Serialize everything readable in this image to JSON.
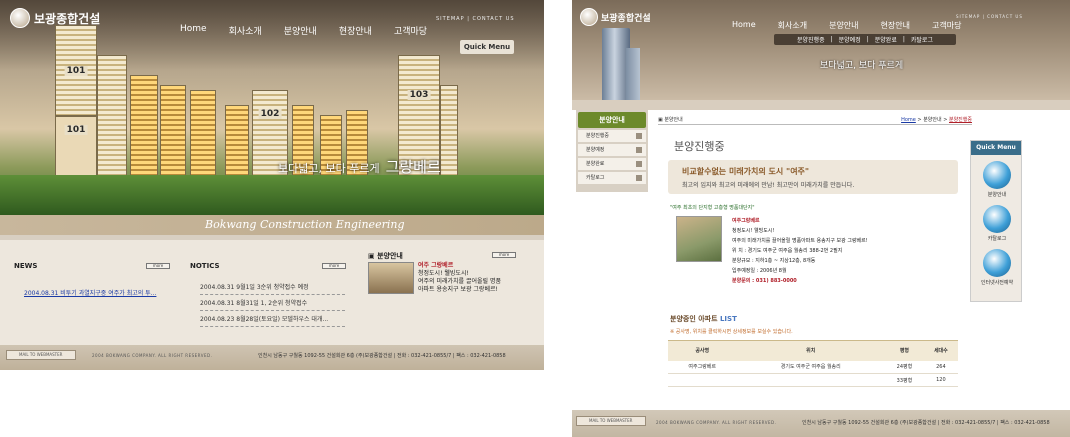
{
  "left": {
    "logo_text": "보광종합건설",
    "nav": [
      "Home",
      "회사소개",
      "분양안내",
      "현장안내",
      "고객마당"
    ],
    "util": "SITEMAP | CONTACT US",
    "quick_menu": "Quick Menu",
    "building_numbers": [
      "101",
      "102",
      "103",
      "101"
    ],
    "slogan_small": "보다넓고, 보다 푸르게",
    "slogan_big": "그랑베르",
    "eng_band": "Bokwang Construction Engineering",
    "news": {
      "title": "NEWS",
      "more": "more",
      "items": [
        "2004.08.31  비투기 과열지구중 여주가 최고의 투..."
      ]
    },
    "notices": {
      "title": "NOTICS",
      "more": "more",
      "items": [
        "2004.08.31  9월1일 3순위 청약접수 예정",
        "2004.08.31  8월31일 1, 2순위 청약접수",
        "2004.08.23  8월28일(토요일) 모델하우스 대개..."
      ]
    },
    "bunyang": {
      "title": "분양안내",
      "more": "more",
      "name": "여주 그랑베르",
      "line1": "청정도시! 웰빙도시!",
      "line2": "여주의 미래가치를 끌어올릴 명품",
      "line3": "아파트 용송지구 보광 그랑베르!"
    },
    "footer": {
      "mail": "MAIL TO WEBMASTER",
      "copyright": "2004 BOKWANG COMPANY. ALL RIGHT RESERVED.",
      "address": "인천시 남동구 구월동 1092-55 건설회관 6층 (주)보광종합건설 | 전화 : 032-421-0855/7 | 팩스 : 032-421-0858"
    }
  },
  "right": {
    "logo_text": "보광종합건설",
    "nav": [
      "Home",
      "회사소개",
      "분양안내",
      "현장안내",
      "고객마당"
    ],
    "util": "SITEMAP | CONTACT US",
    "subnav": [
      "분양진행중",
      "분양예정",
      "분양완료",
      "카탈로그"
    ],
    "slogan": "보다넓고, 보다 푸르게",
    "side": {
      "head": "분양안내",
      "items": [
        "분양진행중",
        "분양예정",
        "분양완료",
        "카탈로그"
      ]
    },
    "crumb": {
      "label": "분양안내",
      "home": "Home",
      "mid": "분양안내",
      "current": "분양진행중"
    },
    "page_title": "분양진행중",
    "highlight": {
      "title": "비교할수없는 미래가치의 도시 \"여주\"",
      "sub": "최고의 입지와 최고의 미래에의 만남! 최고만이 미래가치를 만듭니다."
    },
    "sub_tag": "\"여주 최초의 단지형 고층형 명품대단지\"",
    "project": {
      "name": "여주그랑베르",
      "tagline": "청정도시! 웰빙도시!",
      "desc": "여주의 미래가치를 끌어올릴 명품아파트 용송지구 보광 그랑베르!",
      "location": "위 치 : 경기도 여주군 여주읍 월송리 388-2번 2필지",
      "scale": "분양규모 : 지하1층 ~ 지상12층, 8개동",
      "move_in": "입주예정일 : 2006년 8월",
      "tel": "분양문의 : 031) 883-0000"
    },
    "list": {
      "title": "분양중인 아파트",
      "title_tag": "LIST",
      "note": "※ 공사명, 위치를 클릭하시면 상세정보를 보실수 있습니다.",
      "headers": [
        "공사명",
        "위치",
        "평형",
        "세대수"
      ],
      "rows": [
        [
          "여주그랑베르",
          "경기도 여주군 여주읍 월송리",
          "24평형",
          "264"
        ],
        [
          "",
          "",
          "33평형",
          "120"
        ]
      ]
    },
    "quick": {
      "head": "Quick Menu",
      "items": [
        "분양안내",
        "카탈로그",
        "인터넷사전예약"
      ]
    },
    "footer": {
      "mail": "MAIL TO WEBMASTER",
      "copyright": "2004 BOKWANG COMPANY. ALL RIGHT RESERVED.",
      "address": "인천시 남동구 구월동 1092-55 건설회관 6층 (주)보광종합건설 | 전화 : 032-421-0855/7 | 팩스 : 032-421-0858"
    }
  }
}
